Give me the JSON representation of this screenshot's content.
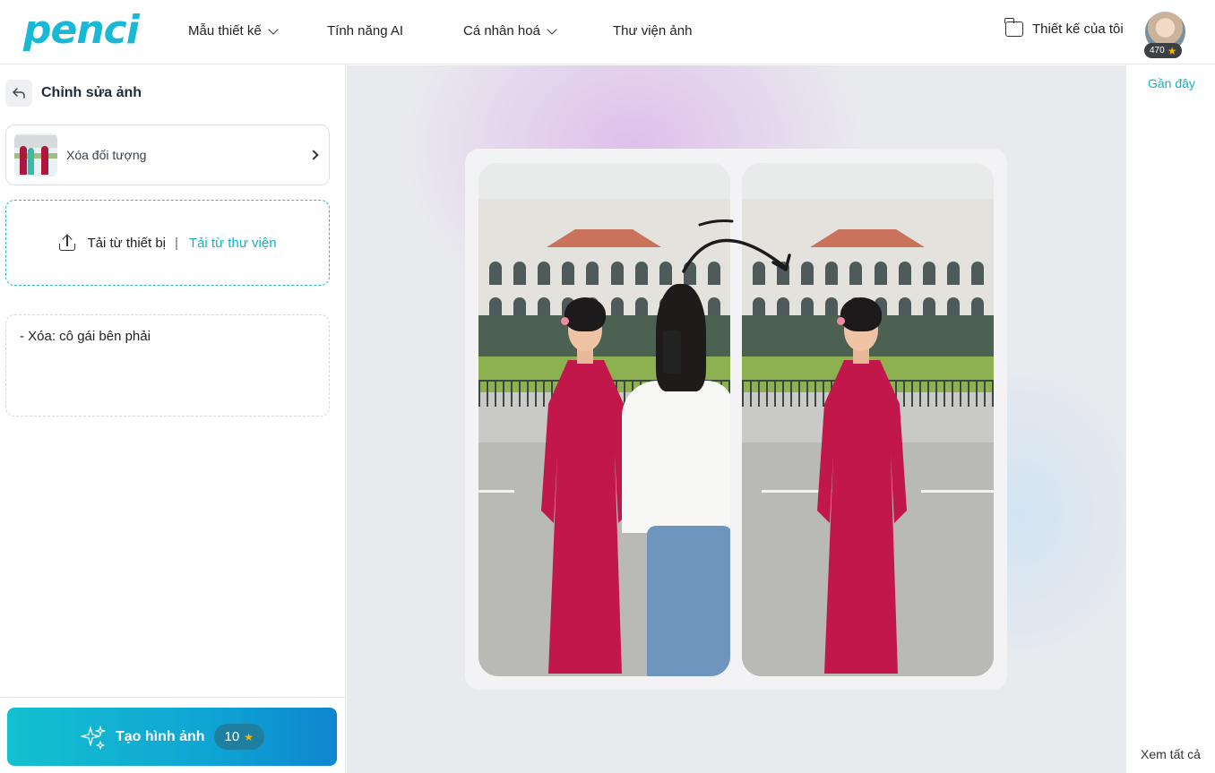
{
  "header": {
    "logo": "penci",
    "nav": [
      {
        "label": "Mẫu thiết kế",
        "has_dropdown": true
      },
      {
        "label": "Tính năng AI",
        "has_dropdown": false
      },
      {
        "label": "Cá nhân hoá",
        "has_dropdown": true
      },
      {
        "label": "Thư viện ảnh",
        "has_dropdown": false
      }
    ],
    "my_designs": "Thiết kế của tôi",
    "credits": "470"
  },
  "left_panel": {
    "title": "Chỉnh sửa ảnh",
    "tool_card": {
      "label": "Xóa đối tượng"
    },
    "upload": {
      "device": "Tải từ thiết bị",
      "separator": "|",
      "library": "Tải từ thư viện"
    },
    "prompt": "-  Xóa: cô gái bên phải",
    "generate": {
      "label": "Tạo hình ảnh",
      "cost": "10"
    }
  },
  "right_panel": {
    "recent": "Gần đây",
    "see_all": "Xem tất cả"
  },
  "colors": {
    "accent": "#11b3c4",
    "generate_gradient_start": "#14c0cf",
    "generate_gradient_end": "#0e86cf",
    "dress": "#c2174b",
    "star": "#f7b500"
  }
}
